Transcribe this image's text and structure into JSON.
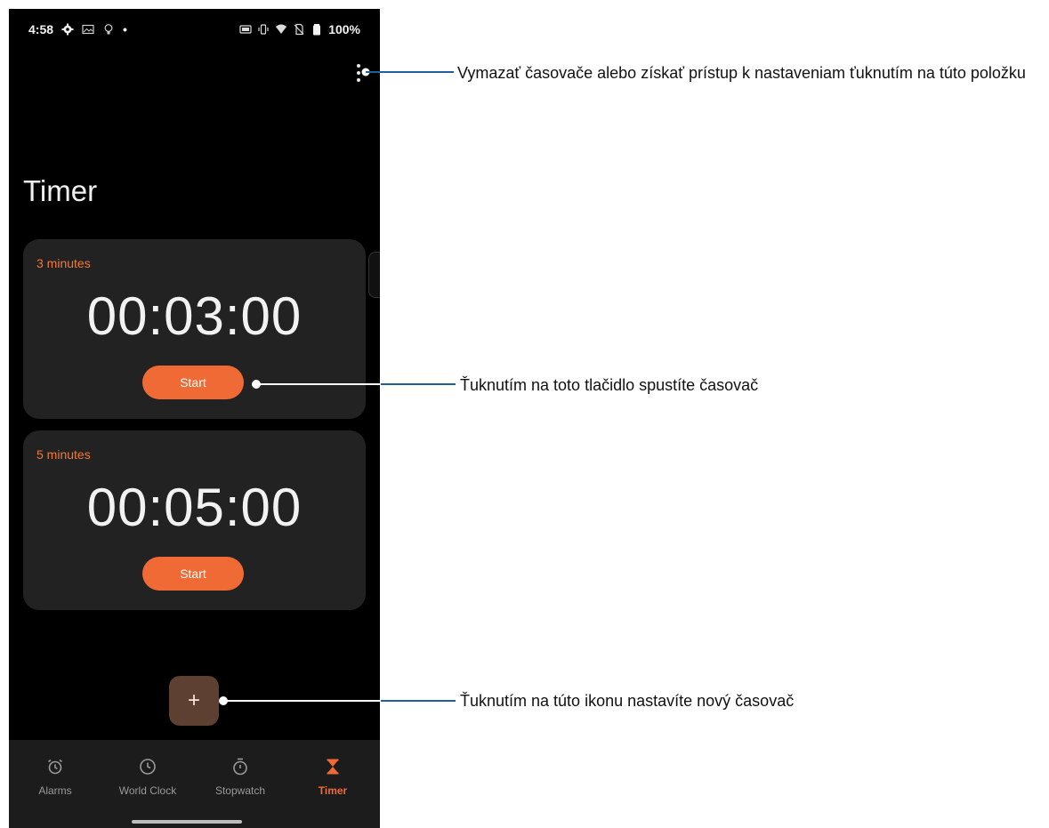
{
  "status_bar": {
    "time": "4:58",
    "bullet": "•",
    "battery": "100%"
  },
  "screen_title": "Timer",
  "timers": [
    {
      "label": "3 minutes",
      "time": "00:03:00",
      "button": "Start"
    },
    {
      "label": "5 minutes",
      "time": "00:05:00",
      "button": "Start"
    }
  ],
  "fab": {
    "icon": "plus-icon",
    "symbol": "+"
  },
  "nav": [
    {
      "label": "Alarms",
      "icon": "alarm-icon"
    },
    {
      "label": "World Clock",
      "icon": "clock-icon"
    },
    {
      "label": "Stopwatch",
      "icon": "stopwatch-icon"
    },
    {
      "label": "Timer",
      "icon": "hourglass-icon",
      "active": true
    }
  ],
  "callouts": {
    "more_menu": "Vymazať časovače alebo získať prístup k nastaveniam ťuknutím na túto položku",
    "start": "Ťuknutím na toto tlačidlo spustíte časovač",
    "add": "Ťuknutím na túto ikonu nastavíte nový časovač"
  },
  "colors": {
    "accent": "#f06a35",
    "card": "#222222",
    "callout_line": "#1f5fa0",
    "fab": "#5e4033"
  }
}
